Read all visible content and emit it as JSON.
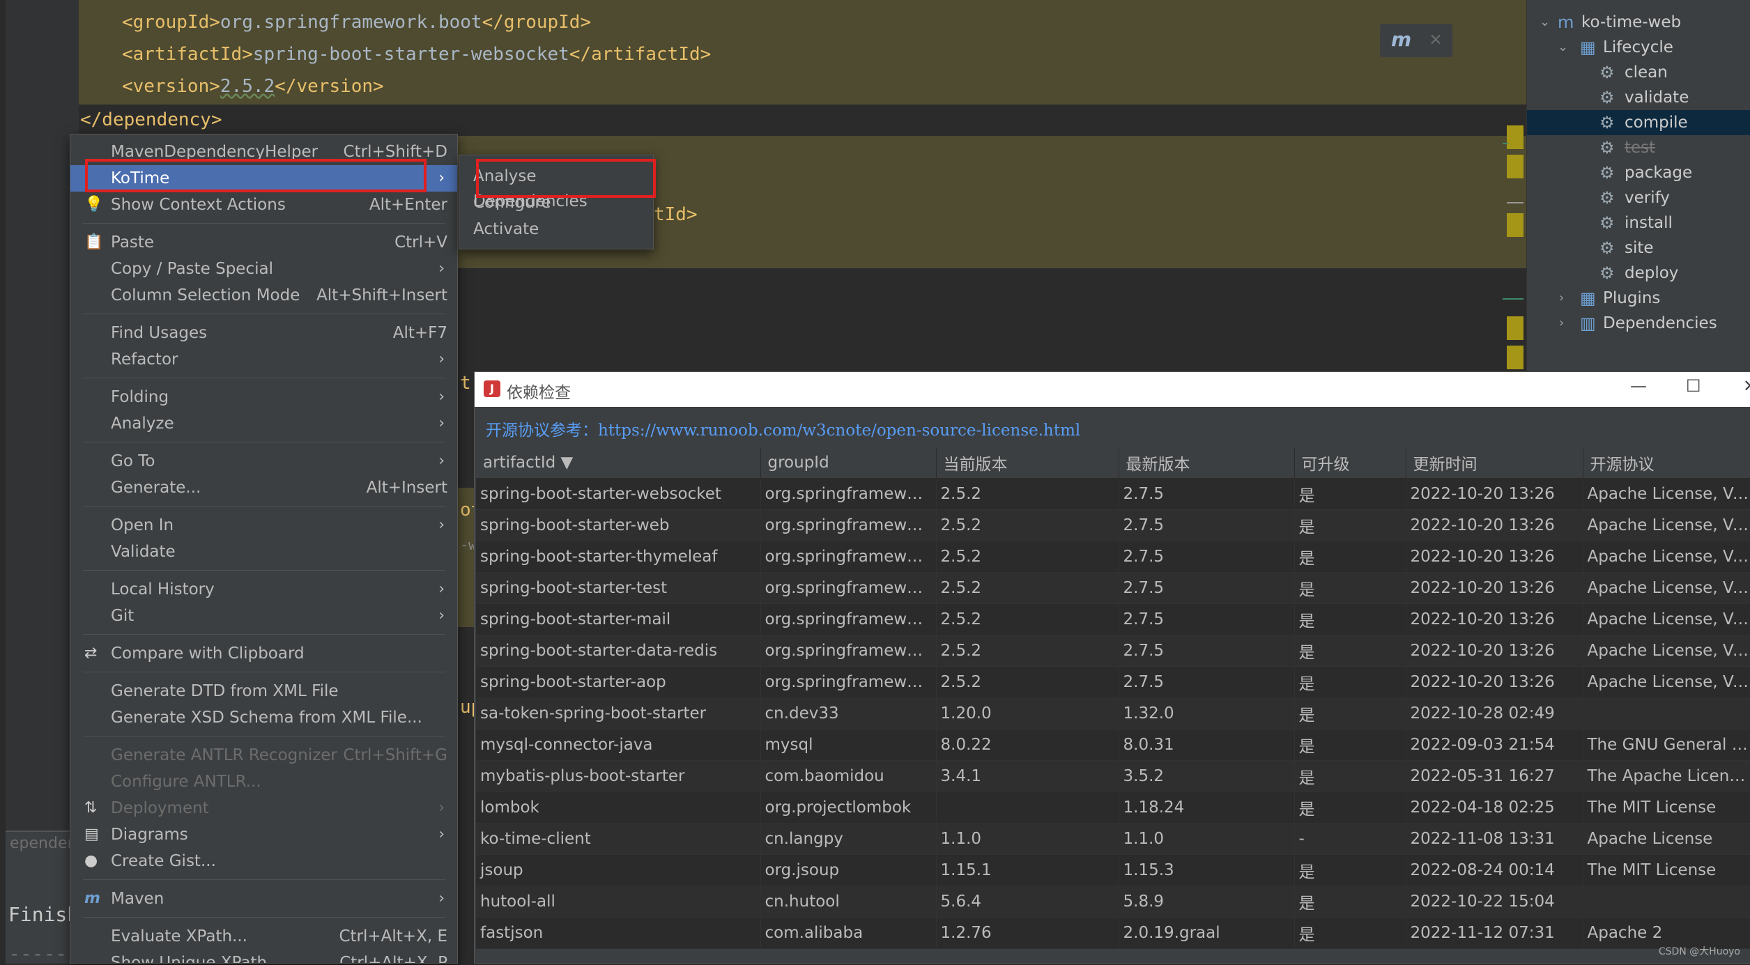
{
  "editor": {
    "code_lines": [
      {
        "open": "<groupId>",
        "value": "org.springframework.boot",
        "close": "</groupId>"
      },
      {
        "open": "<artifactId>",
        "value": "spring-boot-starter-websocket",
        "close": "</artifactId>"
      },
      {
        "open": "<version>",
        "value": "2.5.2",
        "close": "</version>"
      }
    ],
    "closing_tag": "</dependency>",
    "fragment_artifact": "tId>",
    "fragment_ot": "ot",
    "fragment_w": "-w",
    "fragment_up": "up",
    "fragment_t": "t-"
  },
  "maven_float": {
    "icon": "maven-reload-icon",
    "close_icon": "close-icon"
  },
  "bottom_panel": {
    "tab_label": "ependenc",
    "finish_text": "Finish",
    "dashes": "------"
  },
  "maven_tree": {
    "project": "ko-time-web",
    "lifecycle": "Lifecycle",
    "goals": [
      "clean",
      "validate",
      "compile",
      "test",
      "package",
      "verify",
      "install",
      "site",
      "deploy"
    ],
    "selected_goal": "compile",
    "plugins": "Plugins",
    "dependencies": "Dependencies"
  },
  "context_menu": {
    "items": [
      {
        "label": "MavenDependencyHelper",
        "shortcut": "Ctrl+Shift+D"
      },
      {
        "label": "KoTime",
        "submenu": true,
        "selected": true
      },
      {
        "label": "Show Context Actions",
        "shortcut": "Alt+Enter",
        "icon": "bulb-icon"
      },
      {
        "label": "Paste",
        "shortcut": "Ctrl+V",
        "icon": "clipboard-icon"
      },
      {
        "label": "Copy / Paste Special",
        "submenu": true
      },
      {
        "label": "Column Selection Mode",
        "shortcut": "Alt+Shift+Insert"
      },
      {
        "label": "Find Usages",
        "shortcut": "Alt+F7"
      },
      {
        "label": "Refactor",
        "submenu": true
      },
      {
        "label": "Folding",
        "submenu": true
      },
      {
        "label": "Analyze",
        "submenu": true
      },
      {
        "label": "Go To",
        "submenu": true
      },
      {
        "label": "Generate...",
        "shortcut": "Alt+Insert"
      },
      {
        "label": "Open In",
        "submenu": true
      },
      {
        "label": "Validate"
      },
      {
        "label": "Local History",
        "submenu": true
      },
      {
        "label": "Git",
        "submenu": true
      },
      {
        "label": "Compare with Clipboard",
        "icon": "compare-icon"
      },
      {
        "label": "Generate DTD from XML File"
      },
      {
        "label": "Generate XSD Schema from XML File..."
      },
      {
        "label": "Generate ANTLR Recognizer",
        "shortcut": "Ctrl+Shift+G",
        "disabled": true
      },
      {
        "label": "Configure ANTLR...",
        "disabled": true
      },
      {
        "label": "Deployment",
        "submenu": true,
        "disabled": true,
        "icon": "deployment-icon"
      },
      {
        "label": "Diagrams",
        "submenu": true,
        "icon": "diagram-icon"
      },
      {
        "label": "Create Gist...",
        "icon": "github-icon"
      },
      {
        "label": "Maven",
        "submenu": true,
        "icon": "maven-icon"
      },
      {
        "label": "Evaluate XPath...",
        "shortcut": "Ctrl+Alt+X, E"
      },
      {
        "label": "Show Unique XPath",
        "shortcut": "Ctrl+Alt+X, P"
      }
    ]
  },
  "submenu": {
    "items": [
      "Analyse Dependencies",
      "Configure",
      "Activate"
    ]
  },
  "dialog": {
    "title": "依赖检查",
    "link_prefix": "开源协议参考：",
    "link_url": "https://www.runoob.com/w3cnote/open-source-license.html",
    "columns": [
      "artifactId ▼",
      "groupId",
      "当前版本",
      "最新版本",
      "可升级",
      "更新时间",
      "开源协议"
    ],
    "rows": [
      [
        "spring-boot-starter-websocket",
        "org.springframewor...",
        "2.5.2",
        "2.7.5",
        "是",
        "2022-10-20 13:26",
        "Apache License, Ver..."
      ],
      [
        "spring-boot-starter-web",
        "org.springframewor...",
        "2.5.2",
        "2.7.5",
        "是",
        "2022-10-20 13:26",
        "Apache License, Ver..."
      ],
      [
        "spring-boot-starter-thymeleaf",
        "org.springframewor...",
        "2.5.2",
        "2.7.5",
        "是",
        "2022-10-20 13:26",
        "Apache License, Ver..."
      ],
      [
        "spring-boot-starter-test",
        "org.springframewor...",
        "2.5.2",
        "2.7.5",
        "是",
        "2022-10-20 13:26",
        "Apache License, Ver..."
      ],
      [
        "spring-boot-starter-mail",
        "org.springframewor...",
        "2.5.2",
        "2.7.5",
        "是",
        "2022-10-20 13:26",
        "Apache License, Ver..."
      ],
      [
        "spring-boot-starter-data-redis",
        "org.springframewor...",
        "2.5.2",
        "2.7.5",
        "是",
        "2022-10-20 13:26",
        "Apache License, Ver..."
      ],
      [
        "spring-boot-starter-aop",
        "org.springframewor...",
        "2.5.2",
        "2.7.5",
        "是",
        "2022-10-20 13:26",
        "Apache License, Ver..."
      ],
      [
        "sa-token-spring-boot-starter",
        "cn.dev33",
        "1.20.0",
        "1.32.0",
        "是",
        "2022-10-28 02:49",
        ""
      ],
      [
        "mysql-connector-java",
        "mysql",
        "8.0.22",
        "8.0.31",
        "是",
        "2022-09-03 21:54",
        "The GNU General Pu..."
      ],
      [
        "mybatis-plus-boot-starter",
        "com.baomidou",
        "3.4.1",
        "3.5.2",
        "是",
        "2022-05-31 16:27",
        "The Apache License,..."
      ],
      [
        "lombok",
        "org.projectlombok",
        "",
        "1.18.24",
        "是",
        "2022-04-18 02:25",
        "The MIT License"
      ],
      [
        "ko-time-client",
        "cn.langpy",
        "1.1.0",
        "1.1.0",
        "-",
        "2022-11-08 13:31",
        "Apache License"
      ],
      [
        "jsoup",
        "org.jsoup",
        "1.15.1",
        "1.15.3",
        "是",
        "2022-08-24 00:14",
        "The MIT License"
      ],
      [
        "hutool-all",
        "cn.hutool",
        "5.6.4",
        "5.8.9",
        "是",
        "2022-10-22 15:04",
        ""
      ],
      [
        "fastjson",
        "com.alibaba",
        "1.2.76",
        "2.0.19.graal",
        "是",
        "2022-11-12 07:31",
        "Apache 2"
      ]
    ]
  },
  "watermark": "CSDN @大Huoyo",
  "colors": {
    "selection": "#4b6eaf",
    "highlight_box": "#e02020",
    "xml_tag": "#e8bf6a",
    "link": "#589df6"
  }
}
